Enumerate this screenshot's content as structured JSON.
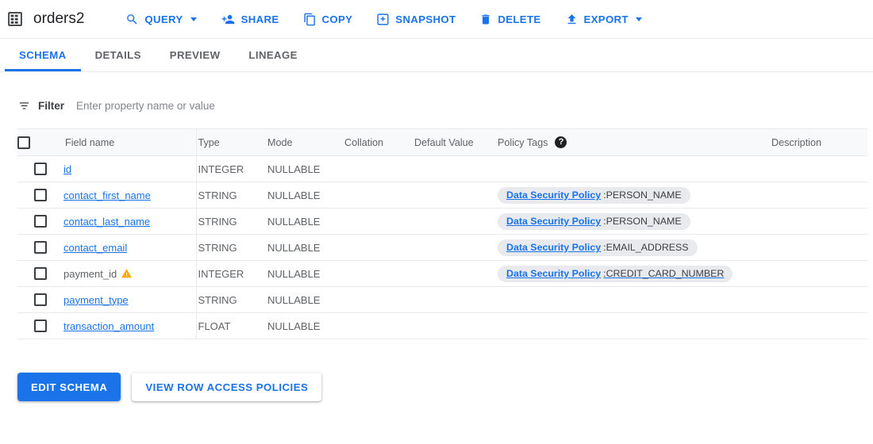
{
  "header": {
    "table_icon": "table-grid-icon",
    "title": "orders2",
    "actions": [
      {
        "label": "QUERY",
        "icon": "search-icon",
        "has_caret": true
      },
      {
        "label": "SHARE",
        "icon": "person-add-icon",
        "has_caret": false
      },
      {
        "label": "COPY",
        "icon": "copy-icon",
        "has_caret": false
      },
      {
        "label": "SNAPSHOT",
        "icon": "snapshot-icon",
        "has_caret": false
      },
      {
        "label": "DELETE",
        "icon": "trash-icon",
        "has_caret": false
      },
      {
        "label": "EXPORT",
        "icon": "upload-icon",
        "has_caret": true
      }
    ]
  },
  "tabs": [
    {
      "label": "SCHEMA",
      "active": true
    },
    {
      "label": "DETAILS",
      "active": false
    },
    {
      "label": "PREVIEW",
      "active": false
    },
    {
      "label": "LINEAGE",
      "active": false
    }
  ],
  "filter": {
    "icon": "filter-icon",
    "label": "Filter",
    "value": "",
    "placeholder": "Enter property name or value"
  },
  "table": {
    "columns": [
      "Field name",
      "Type",
      "Mode",
      "Collation",
      "Default Value",
      "Policy Tags",
      "Description"
    ],
    "policy_tags_help_icon": "help-icon",
    "rows": [
      {
        "checked": false,
        "field": "id",
        "is_link": true,
        "warning": false,
        "type": "INTEGER",
        "mode": "NULLABLE",
        "collation": "",
        "default_value": "",
        "policy_tag": null,
        "description": ""
      },
      {
        "checked": false,
        "field": "contact_first_name",
        "is_link": true,
        "warning": false,
        "type": "STRING",
        "mode": "NULLABLE",
        "collation": "",
        "default_value": "",
        "policy_tag": {
          "name": "Data Security Policy",
          "value": "PERSON_NAME",
          "full_underline": false
        },
        "description": ""
      },
      {
        "checked": false,
        "field": "contact_last_name",
        "is_link": true,
        "warning": false,
        "type": "STRING",
        "mode": "NULLABLE",
        "collation": "",
        "default_value": "",
        "policy_tag": {
          "name": "Data Security Policy",
          "value": "PERSON_NAME",
          "full_underline": false
        },
        "description": ""
      },
      {
        "checked": false,
        "field": "contact_email",
        "is_link": true,
        "warning": false,
        "type": "STRING",
        "mode": "NULLABLE",
        "collation": "",
        "default_value": "",
        "policy_tag": {
          "name": "Data Security Policy",
          "value": "EMAIL_ADDRESS",
          "full_underline": false
        },
        "description": ""
      },
      {
        "checked": false,
        "field": "payment_id",
        "is_link": false,
        "warning": true,
        "type": "INTEGER",
        "mode": "NULLABLE",
        "collation": "",
        "default_value": "",
        "policy_tag": {
          "name": "Data Security Policy",
          "value": "CREDIT_CARD_NUMBER",
          "full_underline": true
        },
        "description": ""
      },
      {
        "checked": false,
        "field": "payment_type",
        "is_link": true,
        "warning": false,
        "type": "STRING",
        "mode": "NULLABLE",
        "collation": "",
        "default_value": "",
        "policy_tag": null,
        "description": ""
      },
      {
        "checked": false,
        "field": "transaction_amount",
        "is_link": true,
        "warning": false,
        "type": "FLOAT",
        "mode": "NULLABLE",
        "collation": "",
        "default_value": "",
        "policy_tag": null,
        "description": ""
      }
    ],
    "policy_separator": " : "
  },
  "footer": {
    "edit_schema_label": "EDIT SCHEMA",
    "view_row_access_policies_label": "VIEW ROW ACCESS POLICIES"
  },
  "colors": {
    "accent_blue": "#1a73e8",
    "text_primary": "#202124",
    "text_secondary": "#5f6368",
    "border": "#e8eaed",
    "header_bg": "#f8f9fa",
    "chip_bg": "#e8eaed",
    "warning_amber": "#f9ab00"
  }
}
